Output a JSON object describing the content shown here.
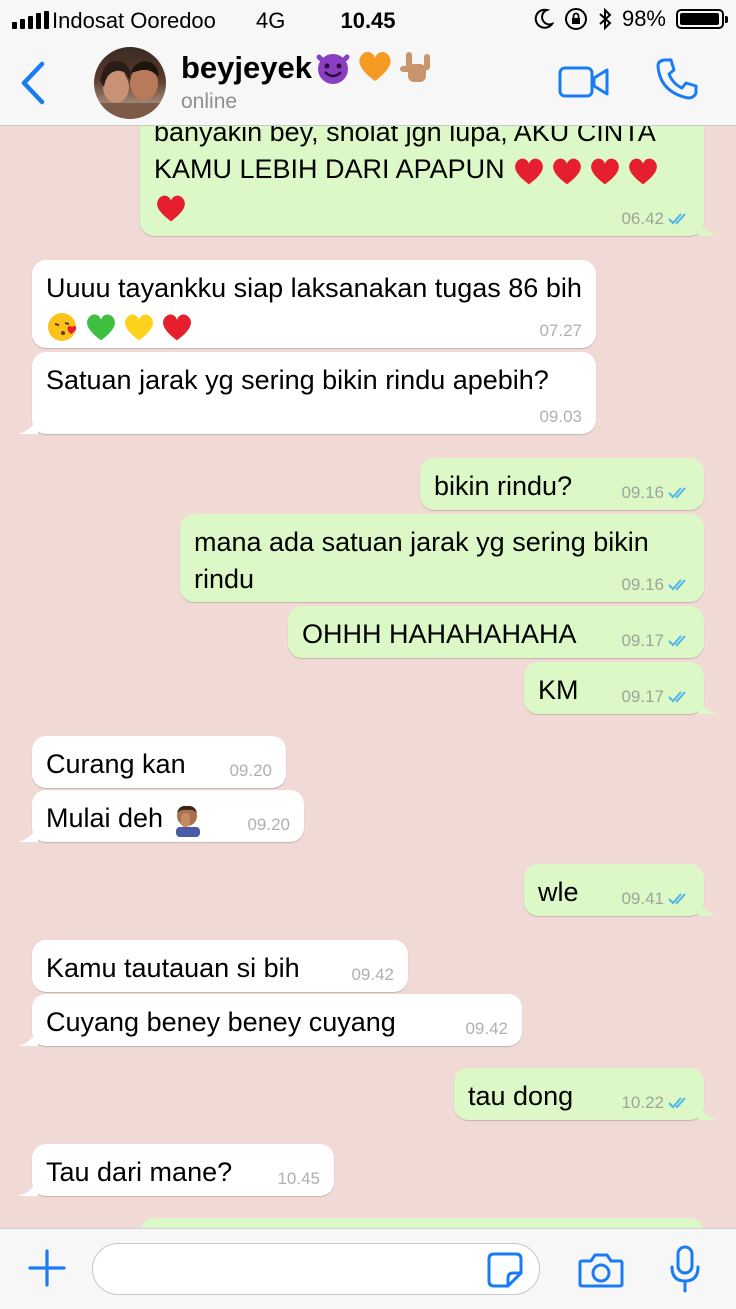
{
  "status_bar": {
    "carrier": "Indosat Ooredoo",
    "network": "4G",
    "time": "10.45",
    "battery_percent": "98%",
    "battery_level": 0.98
  },
  "header": {
    "back_icon": "chevron-left-icon",
    "contact_name": "beyjeyek",
    "contact_status": "online",
    "video_icon": "video-camera-icon",
    "call_icon": "phone-icon",
    "accent_color": "#1a7cf5"
  },
  "messages": [
    {
      "dir": "out",
      "text": "banyakin bey, sholat jgn lupa, AKU CINTA KAMU LEBIH DARI APAPUN",
      "time": "06.42",
      "read": true
    },
    {
      "dir": "in",
      "text": "Uuuu tayankku siap laksanakan tugas 86 bih",
      "time": "07.27"
    },
    {
      "dir": "in",
      "text": "Satuan jarak yg sering bikin rindu apebih?",
      "time": "09.03"
    },
    {
      "dir": "out",
      "text": "bikin rindu?",
      "time": "09.16",
      "read": true
    },
    {
      "dir": "out",
      "text": "mana ada satuan jarak yg sering bikin rindu",
      "time": "09.16",
      "read": true
    },
    {
      "dir": "out",
      "text": "OHHH HAHAHAHAHA",
      "time": "09.17",
      "read": true
    },
    {
      "dir": "out",
      "text": "KM",
      "time": "09.17",
      "read": true
    },
    {
      "dir": "in",
      "text": "Curang kan",
      "time": "09.20"
    },
    {
      "dir": "in",
      "text": "Mulai deh",
      "time": "09.20"
    },
    {
      "dir": "out",
      "text": "wle",
      "time": "09.41",
      "read": true
    },
    {
      "dir": "in",
      "text": "Kamu tautauan si bih",
      "time": "09.42"
    },
    {
      "dir": "in",
      "text": "Cuyang beney beney cuyang",
      "time": "09.42"
    },
    {
      "dir": "out",
      "text": "tau dong",
      "time": "10.22",
      "read": true
    },
    {
      "dir": "in",
      "text": "Tau dari mane?",
      "time": "10.45"
    }
  ],
  "colors": {
    "chat_background": "#f1dad5",
    "outgoing_bubble": "#dcf8c6",
    "incoming_bubble": "#ffffff",
    "read_check": "#4fb6ec"
  },
  "input_bar": {
    "plus_icon": "plus-icon",
    "message_placeholder": "",
    "sticker_icon": "sticker-icon",
    "camera_icon": "camera-icon",
    "mic_icon": "microphone-icon"
  }
}
